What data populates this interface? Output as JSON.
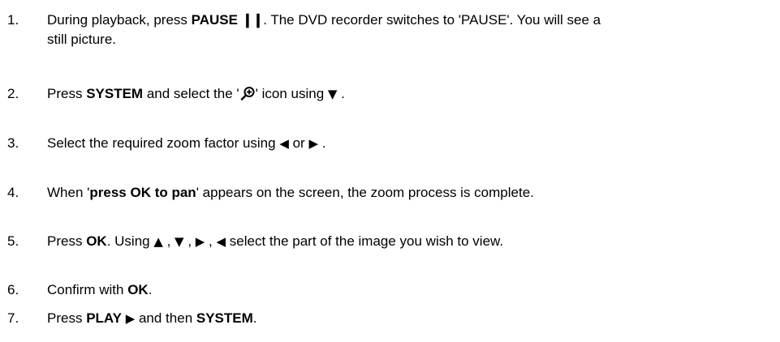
{
  "steps": [
    {
      "number": "1.",
      "parts": {
        "a": "During playback, press ",
        "b_pause": "PAUSE",
        "c": ". The DVD recorder switches to 'PAUSE'. You will see a",
        "d": "still picture."
      },
      "icons": [
        "pause-icon"
      ]
    },
    {
      "number": "2.",
      "parts": {
        "a": "Press ",
        "b_system": "SYSTEM",
        "c": " and select the '",
        "d": "' icon using ",
        "e": " ."
      },
      "icons": [
        "zoom-icon",
        "down-arrow-icon"
      ]
    },
    {
      "number": "3.",
      "parts": {
        "a": "Select the required zoom factor using ",
        "b": " or ",
        "c": " ."
      },
      "icons": [
        "left-arrow-icon",
        "right-arrow-icon"
      ]
    },
    {
      "number": "4.",
      "parts": {
        "a": "When '",
        "b_bold": "press OK to pan",
        "c": "' appears on the screen, the zoom process is complete."
      }
    },
    {
      "number": "5.",
      "parts": {
        "a": "Press ",
        "b_ok": "OK",
        "c": ". Using ",
        "sep": " , ",
        "d": " select the part of the image you wish to view."
      },
      "icons": [
        "up-arrow-icon",
        "down-arrow-icon",
        "right-arrow-icon",
        "left-arrow-icon"
      ]
    },
    {
      "number": "6.",
      "parts": {
        "a": "Confirm with ",
        "b_ok": "OK",
        "c": "."
      }
    },
    {
      "number": "7.",
      "parts": {
        "a": "Press ",
        "b_play": "PLAY",
        "c": " and then ",
        "d_system": "SYSTEM",
        "e": "."
      },
      "icons": [
        "play-icon"
      ]
    }
  ],
  "colors": {
    "text": "#000000",
    "background": "#ffffff"
  }
}
